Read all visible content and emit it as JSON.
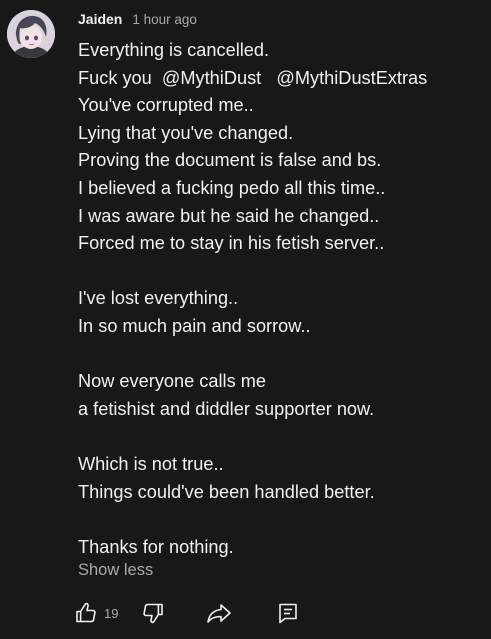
{
  "comment": {
    "author": "Jaiden",
    "timestamp": "1 hour ago",
    "body_lines": {
      "l1": "Everything is cancelled.",
      "l2_prefix": "Fuck you  ",
      "l2_mention1": "@MythiDust",
      "l2_gap": "   ",
      "l2_mention2": "@MythiDustExtras",
      "l3": "You've corrupted me..",
      "l4": "Lying that you've changed.",
      "l5": "Proving the document is false and bs.",
      "l6": "I believed a fucking pedo all this time..",
      "l7": "I was aware but he said he changed..",
      "l8": "Forced me to stay in his fetish server..",
      "l10": "I've lost everything..",
      "l11": "In so much pain and sorrow..",
      "l13": "Now everyone calls me",
      "l14": "a fetishist and diddler supporter now.",
      "l16": "Which is not true..",
      "l17": "Things could've been handled better.",
      "l19": "Thanks for nothing."
    },
    "show_less_label": "Show less",
    "like_count": "19"
  },
  "icons": {
    "like": "thumbs-up-icon",
    "dislike": "thumbs-down-icon",
    "share": "share-icon",
    "reply": "reply-comment-icon"
  },
  "colors": {
    "background": "#181818",
    "text": "#f1f1f1",
    "secondary_text": "#aaaaaa"
  }
}
